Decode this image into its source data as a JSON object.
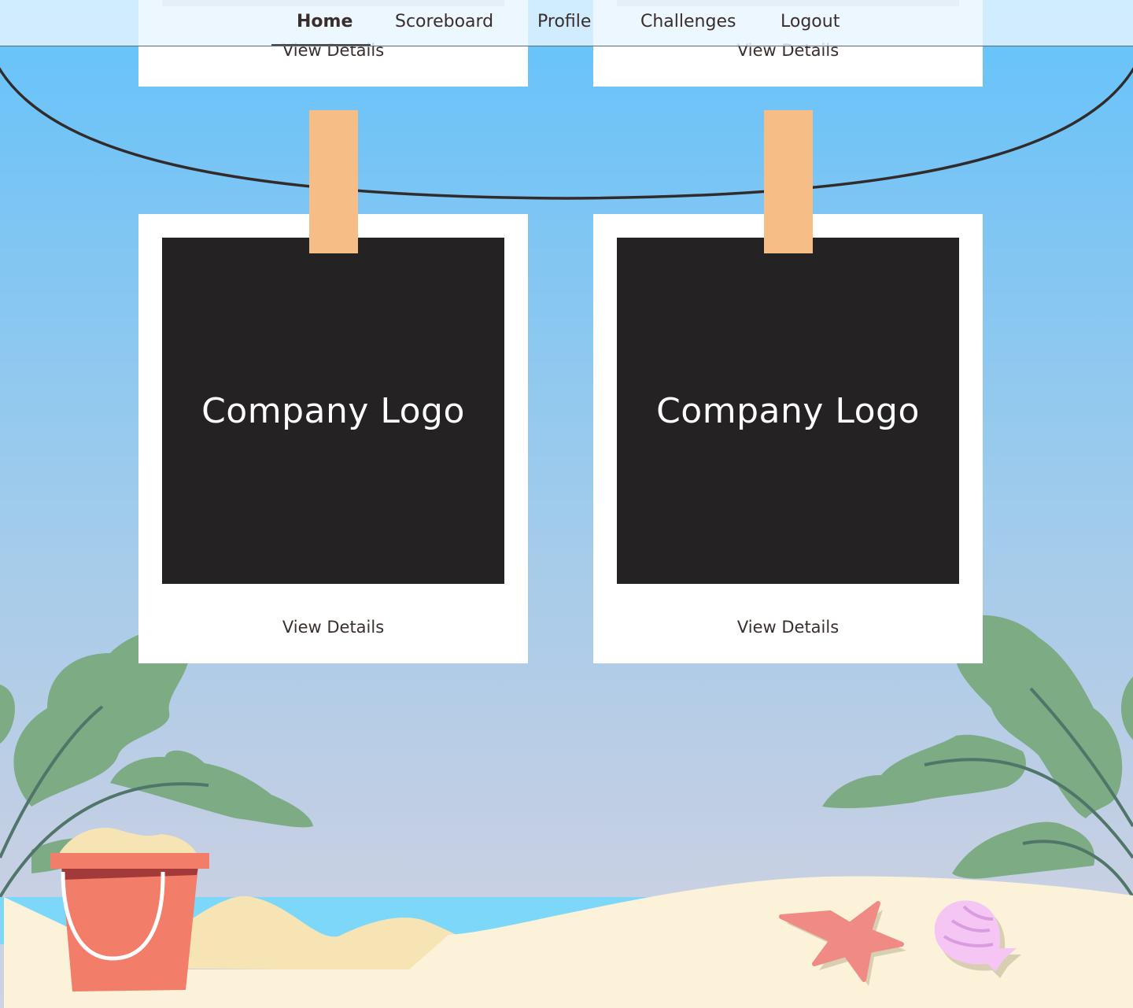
{
  "nav": {
    "items": [
      {
        "label": "Home",
        "active": true
      },
      {
        "label": "Scoreboard",
        "active": false
      },
      {
        "label": "Profile",
        "active": false
      },
      {
        "label": "Challenges",
        "active": false
      },
      {
        "label": "Logout",
        "active": false
      }
    ]
  },
  "cards": {
    "top_left": {
      "details_label": "View Details"
    },
    "top_right": {
      "details_label": "View Details"
    },
    "left": {
      "logo_text": "Company Logo",
      "details_label": "View Details"
    },
    "right": {
      "logo_text": "Company Logo",
      "details_label": "View Details"
    }
  },
  "colors": {
    "sky_top": "#63c3fb",
    "sky_bottom": "#cdd3e4",
    "card": "#ffffff",
    "photo": "#242223",
    "clip": "#f6bd87",
    "leaf": "#7dab84",
    "sand": "#fcf2d9",
    "bucket": "#f27d69",
    "starfish": "#ef8a84",
    "shell": "#f5c6f3"
  }
}
